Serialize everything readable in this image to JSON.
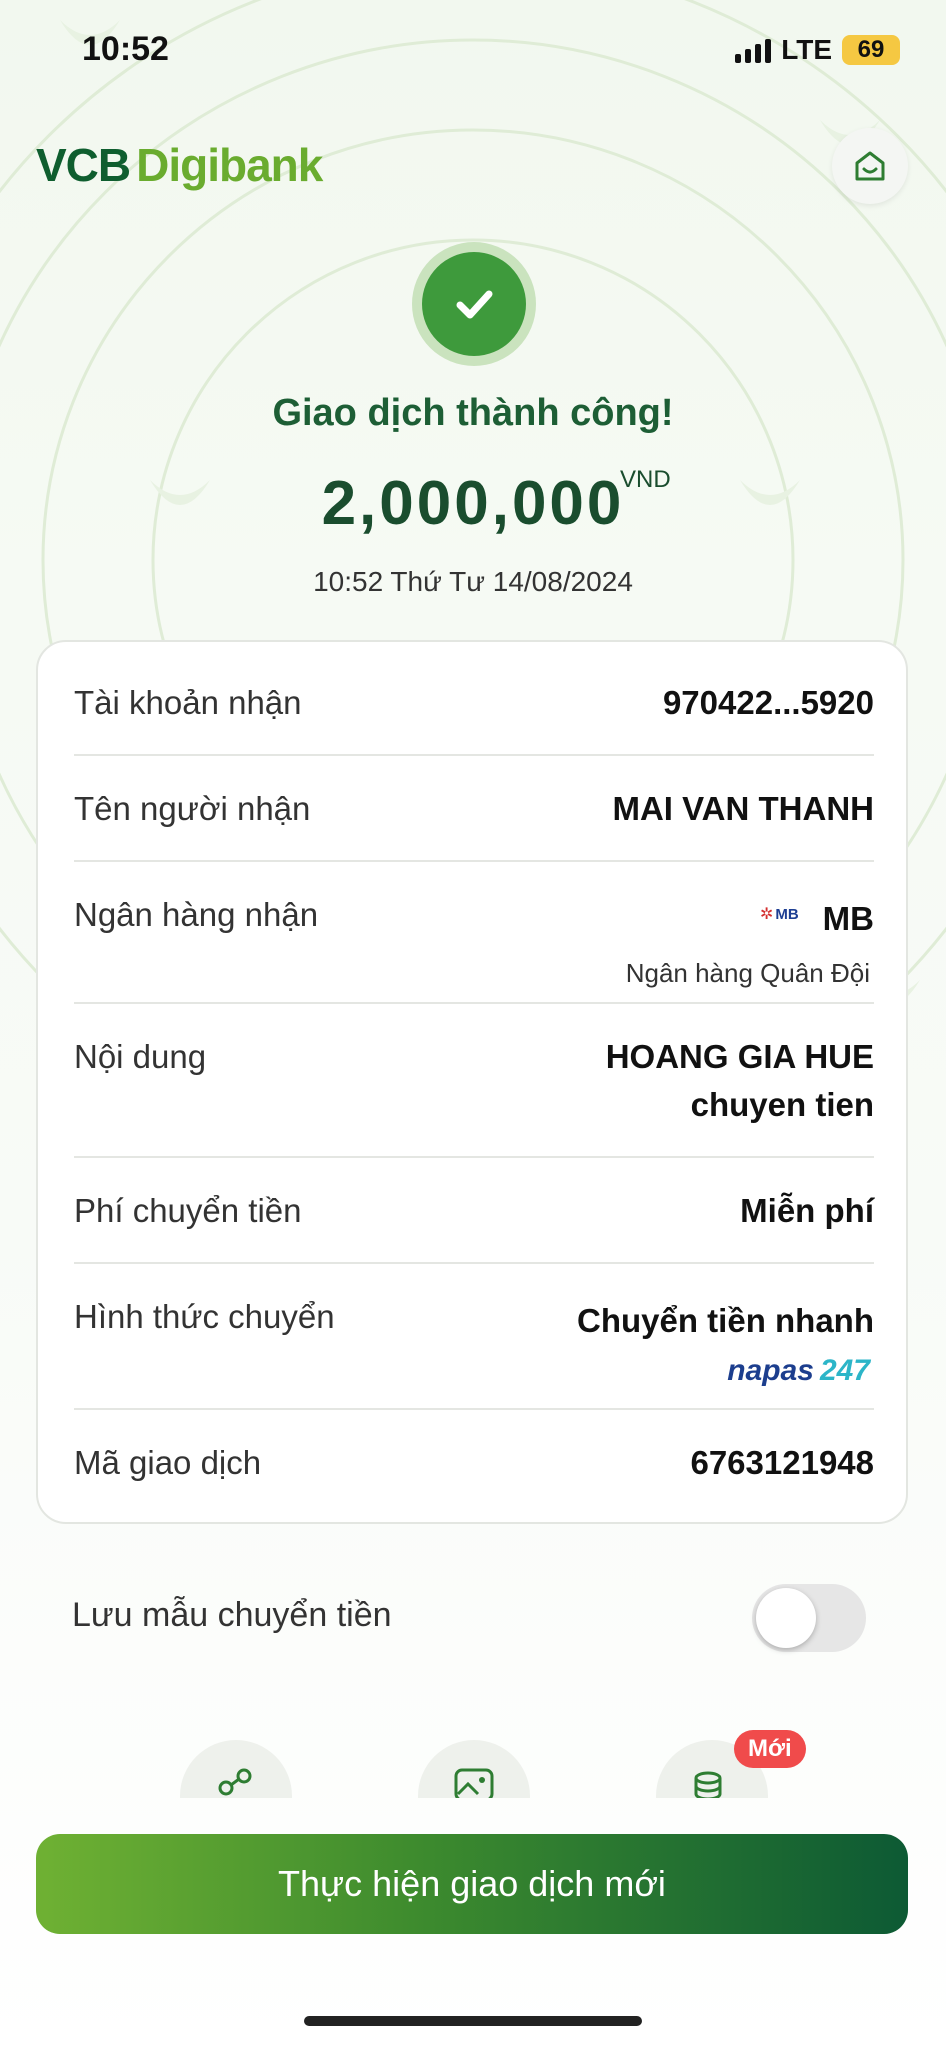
{
  "status_bar": {
    "time": "10:52",
    "network": "LTE",
    "battery": "69",
    "battery_color": "#f5c842"
  },
  "header": {
    "logo_part1": "VCB",
    "logo_part2": "Digibank",
    "home_icon": "home-icon"
  },
  "transaction": {
    "status_icon": "check-icon",
    "title": "Giao dịch thành công!",
    "amount": "2,000,000",
    "currency": "VND",
    "datetime": "10:52 Thứ Tư 14/08/2024"
  },
  "details": [
    {
      "label": "Tài khoản nhận",
      "value": "970422...5920"
    },
    {
      "label": "Tên người nhận",
      "value": "MAI VAN THANH"
    },
    {
      "label": "Ngân hàng nhận",
      "value": "MB",
      "sub": "Ngân hàng Quân Đội",
      "logo_text": "MB"
    },
    {
      "label": "Nội dung",
      "value_line1": "HOANG GIA HUE",
      "value_line2": "chuyen tien"
    },
    {
      "label": "Phí chuyển tiền",
      "value": "Miễn phí"
    },
    {
      "label": "Hình thức chuyển",
      "value": "Chuyển tiền nhanh",
      "logo_part1": "napas",
      "logo_part2": "247"
    },
    {
      "label": "Mã giao dịch",
      "value": "6763121948"
    }
  ],
  "save_template": {
    "label": "Lưu mẫu chuyển tiền",
    "enabled": false
  },
  "quick_actions": {
    "icons": [
      "share-icon",
      "image-icon",
      "coins-icon"
    ],
    "badge": "Mới"
  },
  "cta": {
    "label": "Thực hiện giao dịch mới"
  },
  "colors": {
    "brand_dark": "#0f5e2f",
    "brand_light": "#6aac2f",
    "badge": "#f04b4b"
  }
}
